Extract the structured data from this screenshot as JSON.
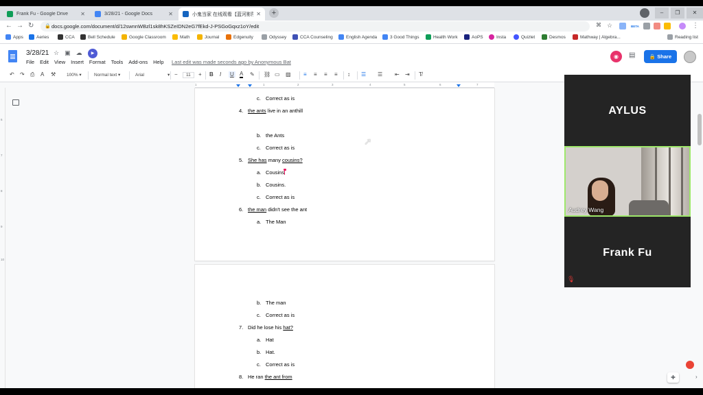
{
  "browser": {
    "tabs": [
      {
        "title": "Frank Fu - Google Drive",
        "color": "#0f9d58"
      },
      {
        "title": "3/28/21 - Google Docs",
        "color": "#4285f4"
      },
      {
        "title": "小鬼当家 在线观看【蓝河影院】- ",
        "color": "#1565c0"
      }
    ],
    "url": "docs.google.com/document/d/12swnnWBzl1sk8hKSZeIDN2eG7fEkd-J-PSGoGqxz1oY/edit",
    "bookmarks": [
      "Apps",
      "Aeries",
      "CCA",
      "Bell Schedule",
      "Google Classroom",
      "Math",
      "Journal",
      "Edgenuity",
      "Odyssey",
      "CCA Counseling",
      "English Agenda",
      "3 Good Things",
      "Health Work",
      "AoPS",
      "Insta",
      "Quizlet",
      "Desmos",
      "Mathway | Algebra..."
    ],
    "reading_list": "Reading list",
    "beta_badge": "BETA"
  },
  "docs": {
    "title": "3/28/21",
    "menu": [
      "File",
      "Edit",
      "View",
      "Insert",
      "Format",
      "Tools",
      "Add-ons",
      "Help"
    ],
    "last_edit": "Last edit was made seconds ago by Anonymous Bat",
    "share_label": "Share",
    "toolbar": {
      "zoom": "100%",
      "style": "Normal text",
      "font": "Arial",
      "font_size": "11"
    }
  },
  "page1": {
    "lines": [
      {
        "kind": "opt",
        "num": "c.",
        "text": "Correct as is"
      },
      {
        "kind": "q",
        "num": "4.",
        "u": "the ants",
        "rest": " live in an anthill"
      },
      {
        "kind": "opt",
        "num": "b.",
        "text": "the Ants"
      },
      {
        "kind": "opt",
        "num": "c.",
        "text": "Correct as is"
      },
      {
        "kind": "q",
        "num": "5.",
        "u": "She has",
        "mid": " many ",
        "u2": "cousins?"
      },
      {
        "kind": "opt",
        "num": "a.",
        "text": "Cousins"
      },
      {
        "kind": "opt",
        "num": "b.",
        "text": "Cousins."
      },
      {
        "kind": "opt",
        "num": "c.",
        "text": "Correct as is"
      },
      {
        "kind": "q",
        "num": "6.",
        "u": "the man",
        "rest": " didn't see the ant"
      },
      {
        "kind": "opt",
        "num": "a.",
        "text": "The Man"
      }
    ]
  },
  "page2": {
    "lines": [
      {
        "kind": "opt",
        "num": "b.",
        "text": "The man"
      },
      {
        "kind": "opt",
        "num": "c.",
        "text": "Correct as is"
      },
      {
        "kind": "q",
        "num": "7.",
        "pre": "Did he lose his ",
        "u": "hat?"
      },
      {
        "kind": "opt",
        "num": "a.",
        "text": "Hat"
      },
      {
        "kind": "opt",
        "num": "b.",
        "text": "Hat."
      },
      {
        "kind": "opt",
        "num": "c.",
        "text": "Correct as is"
      },
      {
        "kind": "q",
        "num": "8.",
        "pre": "He ran ",
        "u": "the ant from"
      }
    ]
  },
  "zoom": {
    "participants": [
      "AYLUS",
      "Audrey Wang",
      "Frank Fu"
    ],
    "active_border": "#9ee86a"
  }
}
